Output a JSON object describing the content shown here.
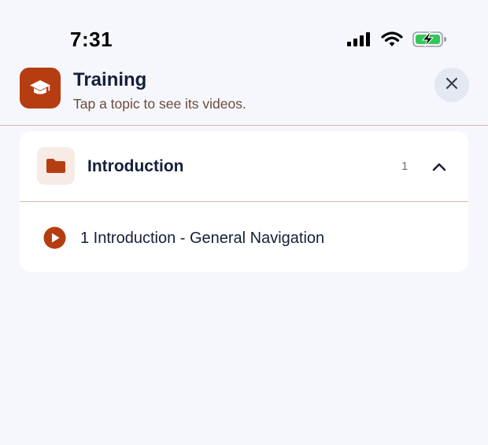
{
  "status_bar": {
    "time": "7:31",
    "icons": [
      "cellular-signal-icon",
      "wifi-icon",
      "battery-charging-icon"
    ]
  },
  "header": {
    "app_icon": "graduation-cap-icon",
    "title": "Training",
    "subtitle": "Tap a topic to see its videos.",
    "close_icon": "close-icon"
  },
  "colors": {
    "accent": "#b63d12",
    "background": "#f6f7fc",
    "card": "#ffffff",
    "title_text": "#14203a",
    "subtitle_text": "#6b4a3e",
    "folder_tile": "#f7ebe6",
    "close_button_bg": "#e4e8f2"
  },
  "topics": [
    {
      "icon": "folder-icon",
      "title": "Introduction",
      "count": "1",
      "expanded": true,
      "videos": [
        {
          "icon": "play-icon",
          "label": "1 Introduction - General Navigation"
        }
      ]
    }
  ]
}
